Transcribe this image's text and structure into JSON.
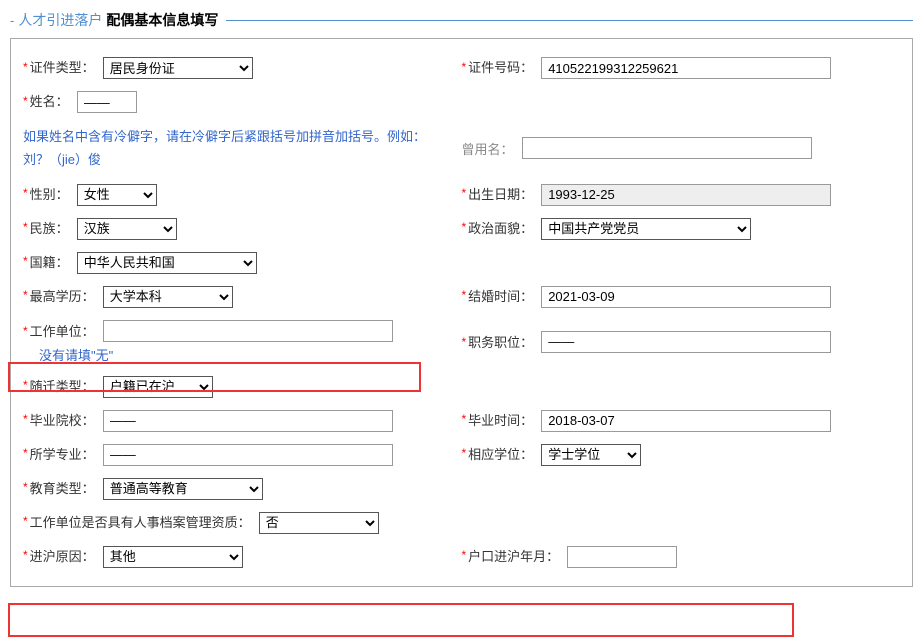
{
  "header": {
    "prefix": "人才引进落户",
    "title": "配偶基本信息填写"
  },
  "labels": {
    "id_type": "证件类型：",
    "id_number": "证件号码：",
    "name": "姓名：",
    "old_name": "曾用名：",
    "gender": "性别：",
    "birth": "出生日期：",
    "nation": "民族：",
    "politics": "政治面貌：",
    "country": "国籍：",
    "edu": "最高学历：",
    "marry": "结婚时间：",
    "work": "工作单位：",
    "position": "职务职位：",
    "move_type": "随迁类型：",
    "school": "毕业院校：",
    "grad_time": "毕业时间：",
    "major": "所学专业：",
    "degree": "相应学位：",
    "edu_type": "教育类型：",
    "archive": "工作单位是否具有人事档案管理资质：",
    "reason": "进沪原因：",
    "entry_date": "户口进沪年月："
  },
  "values": {
    "id_type": "居民身份证",
    "id_number": "410522199312259621",
    "name": "——",
    "old_name": "",
    "gender": "女性",
    "birth": "1993-12-25",
    "nation": "汉族",
    "politics": "中国共产党党员",
    "country": "中华人民共和国",
    "edu": "大学本科",
    "marry": "2021-03-09",
    "work": "",
    "position": "——",
    "move_type": "户籍已在沪",
    "school": "——",
    "grad_time": "2018-03-07",
    "major": "——",
    "degree": "学士学位",
    "edu_type": "普通高等教育",
    "archive": "否",
    "reason": "其他",
    "entry_date": ""
  },
  "hints": {
    "rare_char": "如果姓名中含有冷僻字，请在冷僻字后紧跟括号加拼音加括号。例如：刘？（jie）俊",
    "work_none": "没有请填\"无\""
  }
}
